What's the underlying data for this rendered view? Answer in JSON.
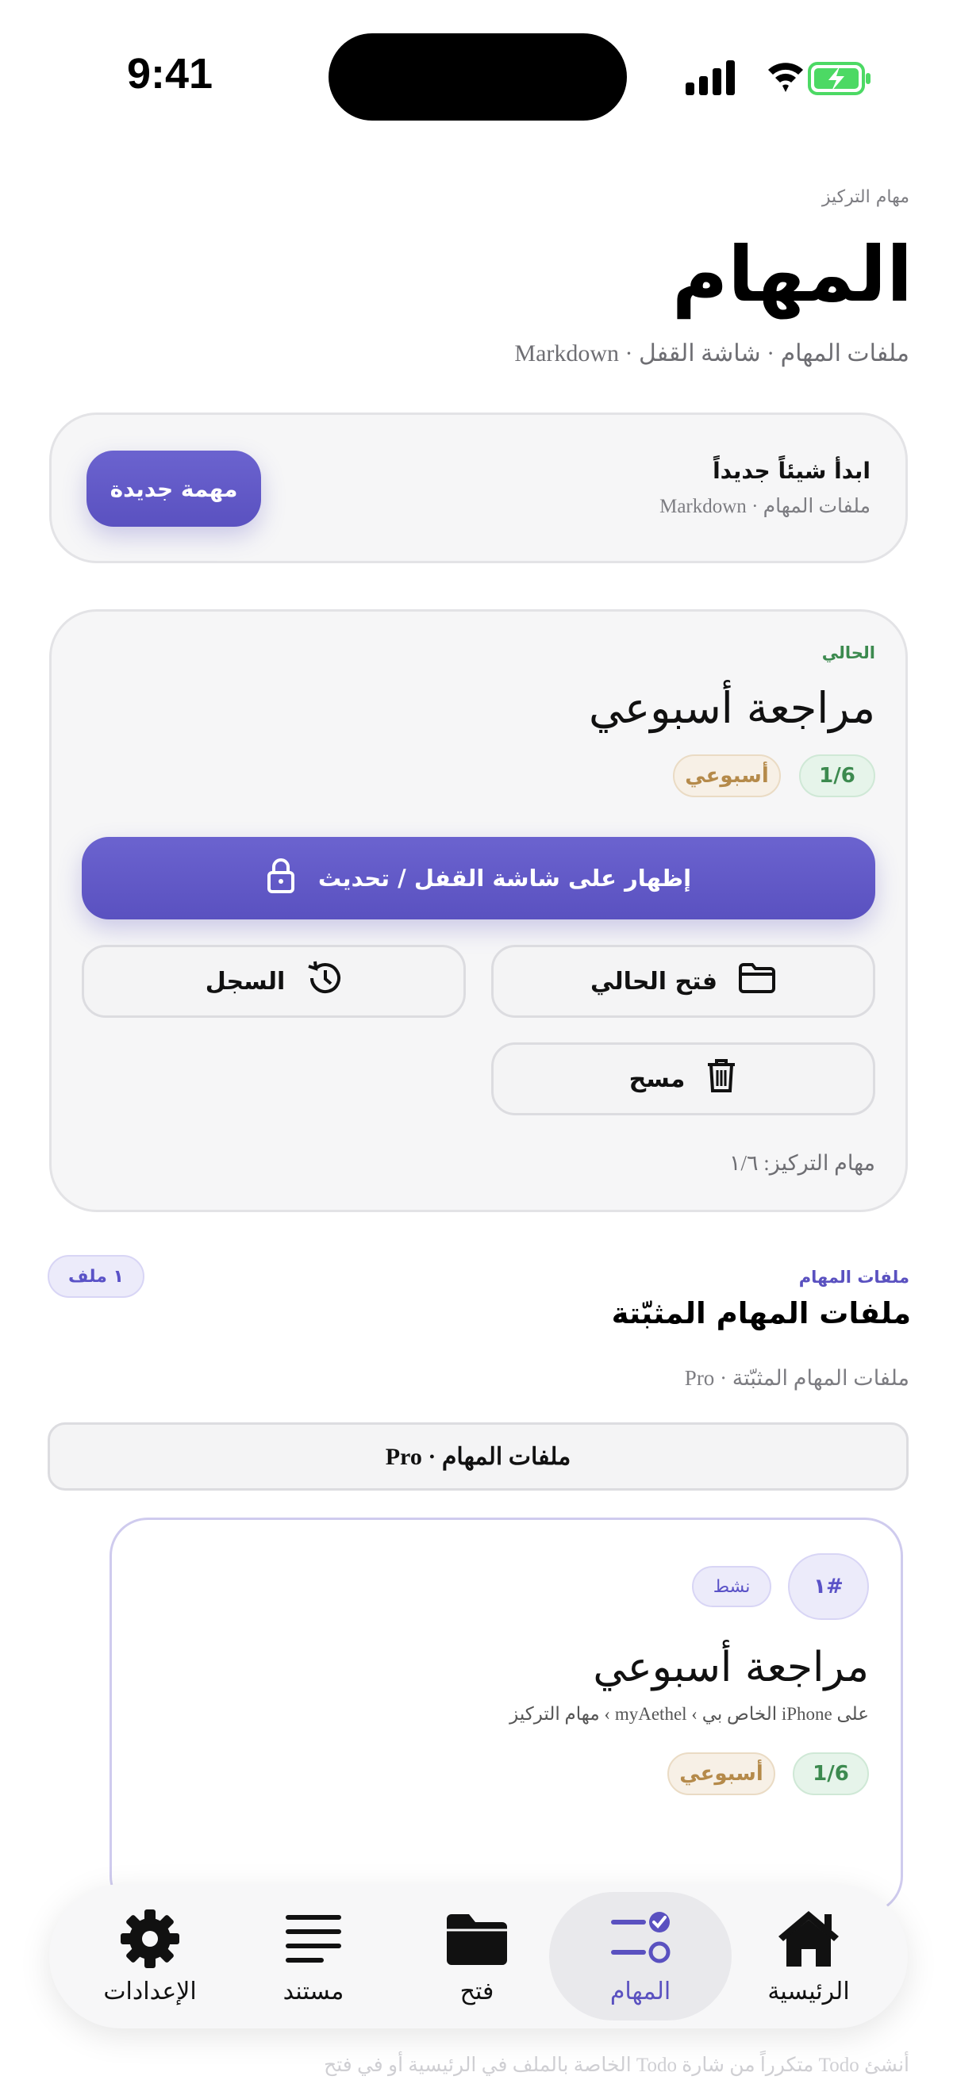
{
  "status_bar": {
    "time": "9:41"
  },
  "header": {
    "eyebrow": "مهام التركيز",
    "title": "المهام",
    "subtitle": "ملفات المهام · شاشة القفل · Markdown"
  },
  "new_card": {
    "title": "ابدأ شيئاً جديداً",
    "subtitle": "ملفات المهام · Markdown",
    "button": "مهمة جديدة"
  },
  "current_card": {
    "tag": "الحالي",
    "title": "مراجعة أسبوعي",
    "progress_badge": "1/6",
    "period_badge": "أسبوعي",
    "lock_button": "إظهار على شاشة القفل / تحديث",
    "open_button": "فتح الحالي",
    "history_button": "السجل",
    "clear_button": "مسح",
    "footer": "مهام التركيز: ١/٦"
  },
  "pinned": {
    "eyebrow": "ملفات المهام",
    "title": "ملفات المهام المثبّتة",
    "count_badge": "١ ملف",
    "subtitle": "ملفات المهام المثبّتة · Pro",
    "pro_button": "ملفات المهام · Pro",
    "item": {
      "index_badge": "#١",
      "status_badge": "نشط",
      "title": "مراجعة أسبوعي",
      "path": "على iPhone الخاص بي › myAethel › مهام التركيز",
      "progress_badge": "1/6",
      "period_badge": "أسبوعي"
    }
  },
  "faded_text": "أنشئ Todo متكرراً من شارة Todo الخاصة بالملف في الرئيسية أو في فتح",
  "nav": {
    "items": [
      {
        "label": "الرئيسية",
        "icon": "home-icon"
      },
      {
        "label": "المهام",
        "icon": "tasks-icon"
      },
      {
        "label": "فتح",
        "icon": "folder-icon"
      },
      {
        "label": "مستند",
        "icon": "document-icon"
      },
      {
        "label": "الإعدادات",
        "icon": "gear-icon"
      }
    ],
    "active": "المهام"
  },
  "colors": {
    "accent": "#5a51c0",
    "green": "#3c8a4f",
    "amber": "#b58a4a",
    "battery": "#4cd964"
  }
}
